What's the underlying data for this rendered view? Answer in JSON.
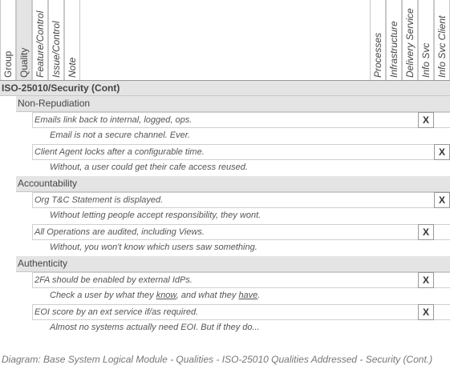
{
  "columns_left": [
    "Group",
    "Quality",
    "Feature/Control",
    "Issue/Control",
    "Note"
  ],
  "columns_right": [
    "Processes",
    "Infrastructure",
    "Delivery Service",
    "Info Svc",
    "Info Svc Client"
  ],
  "section_title": "ISO-25010/Security (Cont)",
  "groups": [
    {
      "name": "Non-Repudiation",
      "rows": [
        {
          "feature": "Emails link back to internal, logged, ops.",
          "mark_col": "Info Svc",
          "mark": "X",
          "note": "Email is not a secure channel. Ever."
        },
        {
          "feature": "Client Agent locks after a configurable time.",
          "mark_col": "Info Svc Client",
          "mark": "X",
          "note": "Without, a user could get their cafe access reused."
        }
      ]
    },
    {
      "name": "Accountability",
      "rows": [
        {
          "feature": "Org T&C Statement is displayed.",
          "mark_col": "Info Svc Client",
          "mark": "X",
          "note": "Without letting people accept responsibility, they wont."
        },
        {
          "feature": "All Operations are audited, including Views.",
          "mark_col": "Info Svc",
          "mark": "X",
          "note": "Without, you won't know which users saw something."
        }
      ]
    },
    {
      "name": "Authenticity",
      "rows": [
        {
          "feature": "2FA should be enabled by external IdPs.",
          "mark_col": "Info Svc",
          "mark": "X",
          "note_parts": [
            "Check a user by what they ",
            "know",
            ", and what they ",
            "have",
            "."
          ]
        },
        {
          "feature": "EOI score by an ext service if/as required.",
          "mark_col": "Info Svc",
          "mark": "X",
          "note": "Almost no systems actually need EOI. But if they do..."
        }
      ]
    }
  ],
  "caption": "Diagram: Base System Logical Module - Qualities - ISO-25010 Qualities Addressed - Security (Cont.)"
}
